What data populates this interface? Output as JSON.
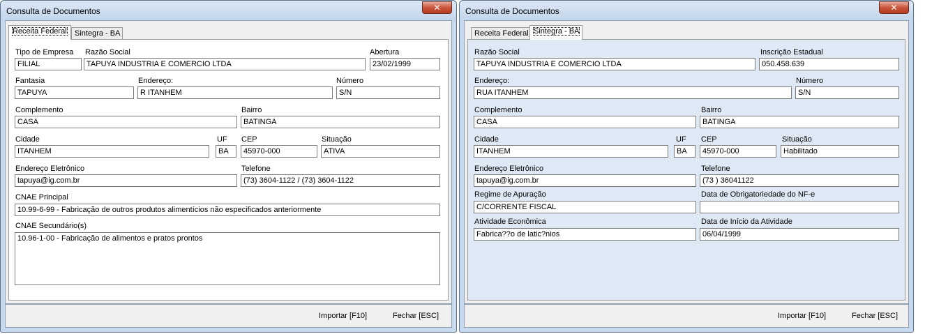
{
  "left": {
    "title": "Consulta de Documentos",
    "close_symbol": "✕",
    "tabs": [
      "Receita Federal",
      "Sintegra - BA"
    ],
    "labels": {
      "tipo_empresa": "Tipo de Empresa",
      "razao_social": "Razão Social",
      "abertura": "Abertura",
      "fantasia": "Fantasia",
      "endereco": "Endereço:",
      "numero": "Número",
      "complemento": "Complemento",
      "bairro": "Bairro",
      "cidade": "Cidade",
      "uf": "UF",
      "cep": "CEP",
      "situacao": "Situação",
      "email": "Endereço Eletrônico",
      "telefone": "Telefone",
      "cnae_principal": "CNAE Principal",
      "cnae_secundario": "CNAE Secundário(s)"
    },
    "values": {
      "tipo_empresa": "FILIAL",
      "razao_social": "TAPUYA INDUSTRIA E COMERCIO LTDA",
      "abertura": "23/02/1999",
      "fantasia": "TAPUYA",
      "endereco": "R ITANHEM",
      "numero": "S/N",
      "complemento": "CASA",
      "bairro": "BATINGA",
      "cidade": "ITANHEM",
      "uf": "BA",
      "cep": "45970-000",
      "situacao": "ATIVA",
      "email": "tapuya@ig.com.br",
      "telefone": "(73) 3604-1122 / (73) 3604-1122",
      "cnae_principal": "10.99-6-99 - Fabricação de outros produtos alimentícios não especificados anteriormente",
      "cnae_secundario": "10.96-1-00 - Fabricação de alimentos e pratos prontos"
    },
    "buttons": {
      "importar": "Importar [F10]",
      "fechar": "Fechar [ESC]"
    }
  },
  "right": {
    "title": "Consulta de Documentos",
    "close_symbol": "✕",
    "tabs": [
      "Receita Federal",
      "Sintegra - BA"
    ],
    "labels": {
      "razao_social": "Razão Social",
      "inscricao": "Inscrição Estadual",
      "endereco": "Endereço:",
      "numero": "Número",
      "complemento": "Complemento",
      "bairro": "Bairro",
      "cidade": "Cidade",
      "uf": "UF",
      "cep": "CEP",
      "situacao": "Situação",
      "email": "Endereço Eletrônico",
      "telefone": "Telefone",
      "regime": "Regime de Apuração",
      "data_obrig": "Data de Obrigatoriedade do NF-e",
      "atividade": "Atividade Econômica",
      "data_inicio": "Data de Início da Atividade"
    },
    "values": {
      "razao_social": "TAPUYA INDUSTRIA E COMERCIO LTDA",
      "inscricao": "050.458.639",
      "endereco": "RUA ITANHEM",
      "numero": "S/N",
      "complemento": "CASA",
      "bairro": "BATINGA",
      "cidade": "ITANHEM",
      "uf": "BA",
      "cep": "45970-000",
      "situacao": "Habilitado",
      "email": "tapuya@ig.com.br",
      "telefone": "(73 ) 36041122",
      "regime": "C/CORRENTE FISCAL",
      "data_obrig": "",
      "atividade": "Fabrica??o de latic?nios",
      "data_inicio": "06/04/1999"
    },
    "buttons": {
      "importar": "Importar [F10]",
      "fechar": "Fechar [ESC]"
    }
  }
}
